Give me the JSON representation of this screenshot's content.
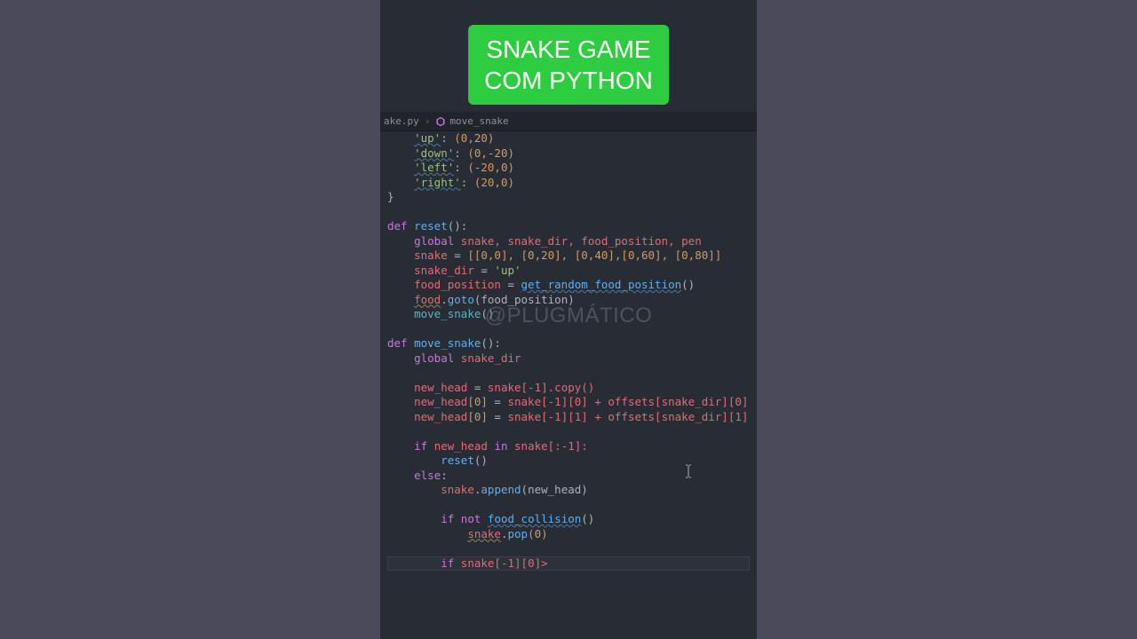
{
  "badge": {
    "line1": "SNAKE GAME",
    "line2": "COM PYTHON"
  },
  "breadcrumb": {
    "file_fragment": "ake.py",
    "symbol": "move_snake"
  },
  "watermark": "@PLUGMÁTICO",
  "code": {
    "l01_key": "'up'",
    "l01_val": "(0,20)",
    "l02_key": "'down'",
    "l02_val": "(0,-20)",
    "l03_key": "'left'",
    "l03_val": "(-20,0)",
    "l04_key": "'right'",
    "l04_val": "(20,0)",
    "l05": "}",
    "l07_def": "def",
    "l07_name": "reset",
    "l07_rest": "():",
    "l08_kw": "global",
    "l08_vars": " snake, snake_dir, food_position, pen",
    "l09_lhs": "snake",
    "l09_eq": " = ",
    "l09_rhs": "[[0,0], [0,20], [0,40],[0,60], [0,80]]",
    "l10_lhs": "snake_dir",
    "l10_eq": " = ",
    "l10_rhs": "'up'",
    "l11_lhs": "food_position",
    "l11_eq": " = ",
    "l11_call": "get_random_food_position",
    "l11_tail": "()",
    "l12_obj": "food",
    "l12_dot": ".",
    "l12_call": "goto",
    "l12_arg": "(food_position)",
    "l13_call": "move_snake",
    "l13_tail": "()",
    "l15_def": "def",
    "l15_name": "move_snake",
    "l15_rest": "():",
    "l16_kw": "global",
    "l16_vars": " snake_dir",
    "l18_lhs": "new_head",
    "l18_eq": " = ",
    "l18_rhs": "snake[-1].copy()",
    "l19_lhs": "new_head",
    "l19_idx": "[0]",
    "l19_eq": " = ",
    "l19_rhs": "snake[-1][0] + offsets[snake_dir][0]",
    "l20_lhs": "new_head",
    "l20_idx": "[0]",
    "l20_eq": " = ",
    "l20_rhs": "snake[-1][1] + offsets[snake_dir][1]",
    "l22_if": "if",
    "l22_cond": " new_head ",
    "l22_in": "in",
    "l22_tail": " snake[:-1]:",
    "l23_call": "reset",
    "l23_tail": "()",
    "l24_else": "else",
    "l24_colon": ":",
    "l25_obj": "snake",
    "l25_dot": ".",
    "l25_call": "append",
    "l25_arg": "(new_head)",
    "l27_if": "if",
    "l27_not": " not ",
    "l27_call": "food_collision",
    "l27_tail": "()",
    "l28_obj": "snake",
    "l28_dot": ".",
    "l28_call": "pop",
    "l28_arg": "(0)",
    "l30_if": "if",
    "l30_rest": " snake[-1][0]>"
  }
}
